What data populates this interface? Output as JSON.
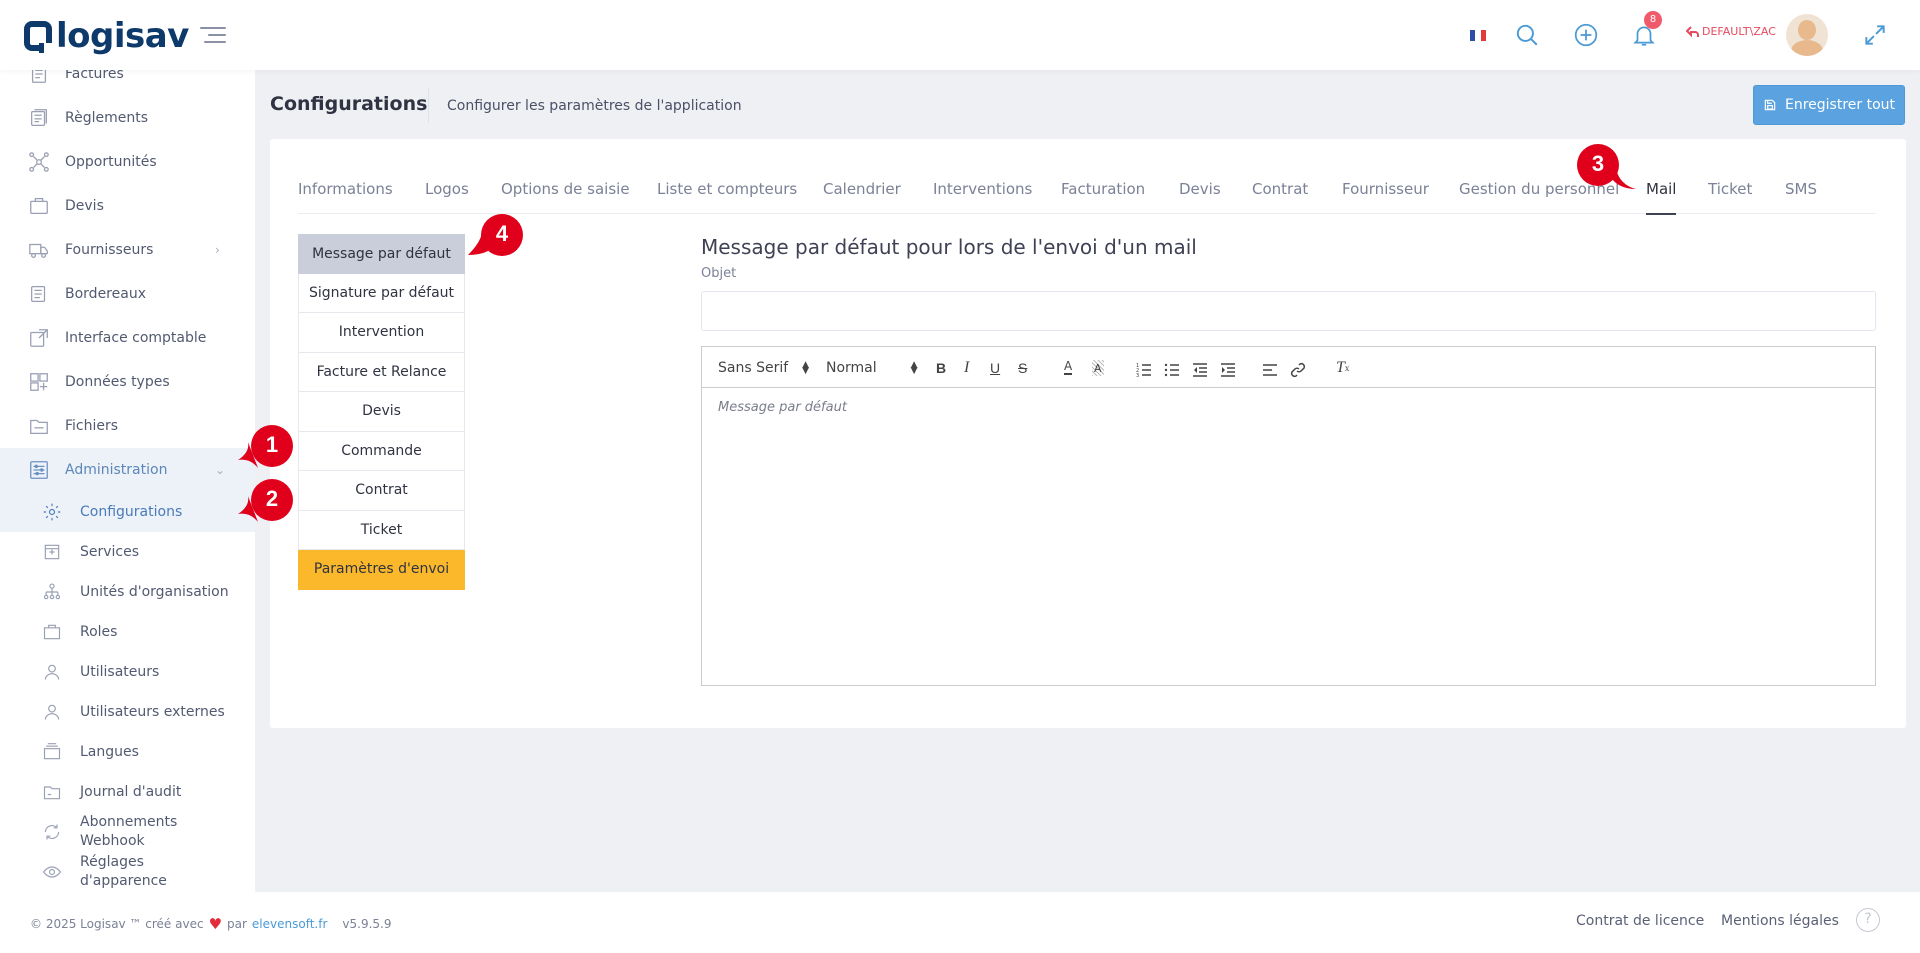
{
  "header": {
    "logo": "logisav",
    "notifications_count": "8",
    "user": "DEFAULT\\ZAC"
  },
  "sidebar": {
    "items": [
      {
        "label": "Factures"
      },
      {
        "label": "Règlements"
      },
      {
        "label": "Opportunités"
      },
      {
        "label": "Devis"
      },
      {
        "label": "Fournisseurs"
      },
      {
        "label": "Bordereaux"
      },
      {
        "label": "Interface comptable"
      },
      {
        "label": "Données types"
      },
      {
        "label": "Fichiers"
      },
      {
        "label": "Administration"
      }
    ],
    "sub_items": [
      {
        "label": "Configurations"
      },
      {
        "label": "Services"
      },
      {
        "label": "Unités d'organisation"
      },
      {
        "label": "Roles"
      },
      {
        "label": "Utilisateurs"
      },
      {
        "label": "Utilisateurs externes"
      },
      {
        "label": "Langues"
      },
      {
        "label": "Journal d'audit"
      },
      {
        "label": "Abonnements Webhook"
      },
      {
        "label": "Réglages d'apparence"
      }
    ]
  },
  "page": {
    "title": "Configurations",
    "subtitle": "Configurer les paramètres de l'application",
    "save_all": "Enregistrer tout"
  },
  "tabs": [
    {
      "label": "Informations"
    },
    {
      "label": "Logos"
    },
    {
      "label": "Options de saisie"
    },
    {
      "label": "Liste et compteurs"
    },
    {
      "label": "Calendrier"
    },
    {
      "label": "Interventions"
    },
    {
      "label": "Facturation"
    },
    {
      "label": "Devis"
    },
    {
      "label": "Contrat"
    },
    {
      "label": "Fournisseur"
    },
    {
      "label": "Gestion du personnel"
    },
    {
      "label": "Mail"
    },
    {
      "label": "Ticket"
    },
    {
      "label": "SMS"
    }
  ],
  "mail_nav": [
    {
      "label": "Message par défaut"
    },
    {
      "label": "Signature par défaut"
    },
    {
      "label": "Intervention"
    },
    {
      "label": "Facture et Relance"
    },
    {
      "label": "Devis"
    },
    {
      "label": "Commande"
    },
    {
      "label": "Contrat"
    },
    {
      "label": "Ticket"
    },
    {
      "label": "Paramètres d'envoi"
    }
  ],
  "form": {
    "title": "Message par défaut pour lors de l'envoi d'un mail",
    "subject_label": "Objet",
    "subject_value": "",
    "font_select": "Sans Serif",
    "size_select": "Normal",
    "body_placeholder": "Message par défaut"
  },
  "footer": {
    "copyright": "© 2025 Logisav ™ créé avec",
    "by": "par",
    "company": "elevensoft.fr",
    "version": "v5.9.5.9",
    "license": "Contrat de licence",
    "legal": "Mentions légales"
  },
  "markers": [
    "1",
    "2",
    "3",
    "4"
  ],
  "colors": {
    "accent": "#5aa3e0",
    "active_sidebar_bg": "#edf2f9",
    "selected_nav": "#c9ceda",
    "orange": "#fbb82a",
    "marker_red": "#e0001b",
    "user_red": "#e64a5e"
  }
}
